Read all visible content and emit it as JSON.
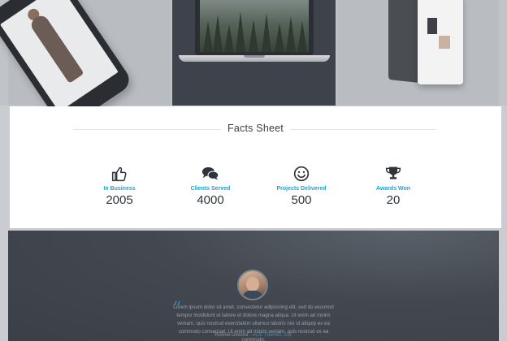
{
  "facts": {
    "title": "Facts Sheet",
    "items": [
      {
        "icon": "thumbs-up-icon",
        "label": "In Business",
        "value": "2005"
      },
      {
        "icon": "chat-bubbles-icon",
        "label": "Clients Served",
        "value": "4000"
      },
      {
        "icon": "smiley-icon",
        "label": "Projects Delivered",
        "value": "500"
      },
      {
        "icon": "trophy-icon",
        "label": "Awards Won",
        "value": "20"
      }
    ]
  },
  "testimonial": {
    "quote": "Lorem ipsum dolor sit amet, consectetur adipisicing elit, sed do eiusmod tempor incididunt ut labore et dolore magna aliqua. Ut enim ad minim veniam, quis nostrud exercitation ullamco laboris nisi ut aliquip ex ea commodo consequat. Ut enim ad minim veniam, quis nostrud ex ea commodo.",
    "author_name": "Ronnie Director",
    "author_company": "- ACE Themes, Ltd."
  },
  "colors": {
    "accent": "#1fa0d6",
    "card": "#ffffff",
    "dark": "#3f444c"
  }
}
